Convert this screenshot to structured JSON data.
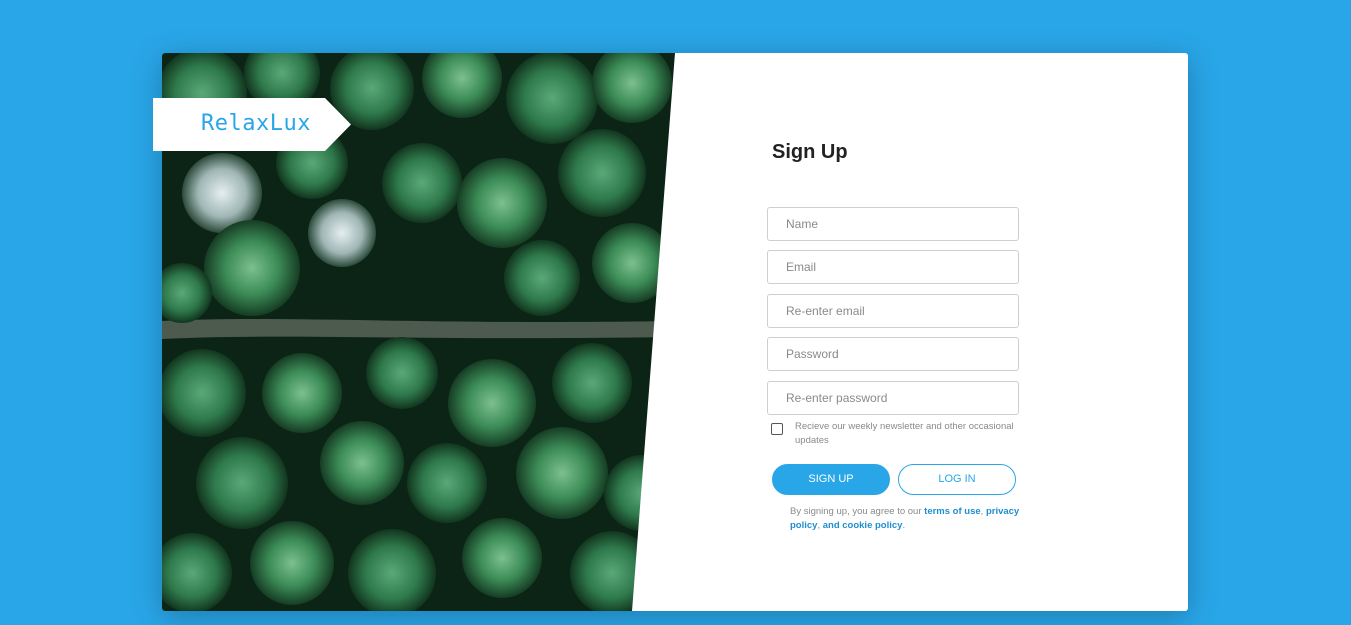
{
  "brand": {
    "name": "RelaxLux",
    "color": "#29a6e8"
  },
  "page": {
    "background": "#29a6e8"
  },
  "form": {
    "title": "Sign Up",
    "fields": [
      {
        "name": "name",
        "placeholder": "Name",
        "value": ""
      },
      {
        "name": "email",
        "placeholder": "Email",
        "value": ""
      },
      {
        "name": "reenter_email",
        "placeholder": "Re-enter email",
        "value": ""
      },
      {
        "name": "password",
        "placeholder": "Password",
        "value": ""
      },
      {
        "name": "reenter_password",
        "placeholder": "Re-enter password",
        "value": ""
      }
    ],
    "newsletter": {
      "label": "Recieve our weekly newsletter and other occasional updates",
      "checked": false
    },
    "signup_label": "SIGN UP",
    "login_label": "LOG IN",
    "legal": {
      "prefix": "By signing up, you agree to our ",
      "terms": "terms of use",
      "sep1": ", ",
      "privacy": "privacy policy",
      "sep2": ", ",
      "cookie": "and cookie policy",
      "suffix": "."
    }
  },
  "hero_image": {
    "description_icon": "forest-aerial-photo"
  }
}
